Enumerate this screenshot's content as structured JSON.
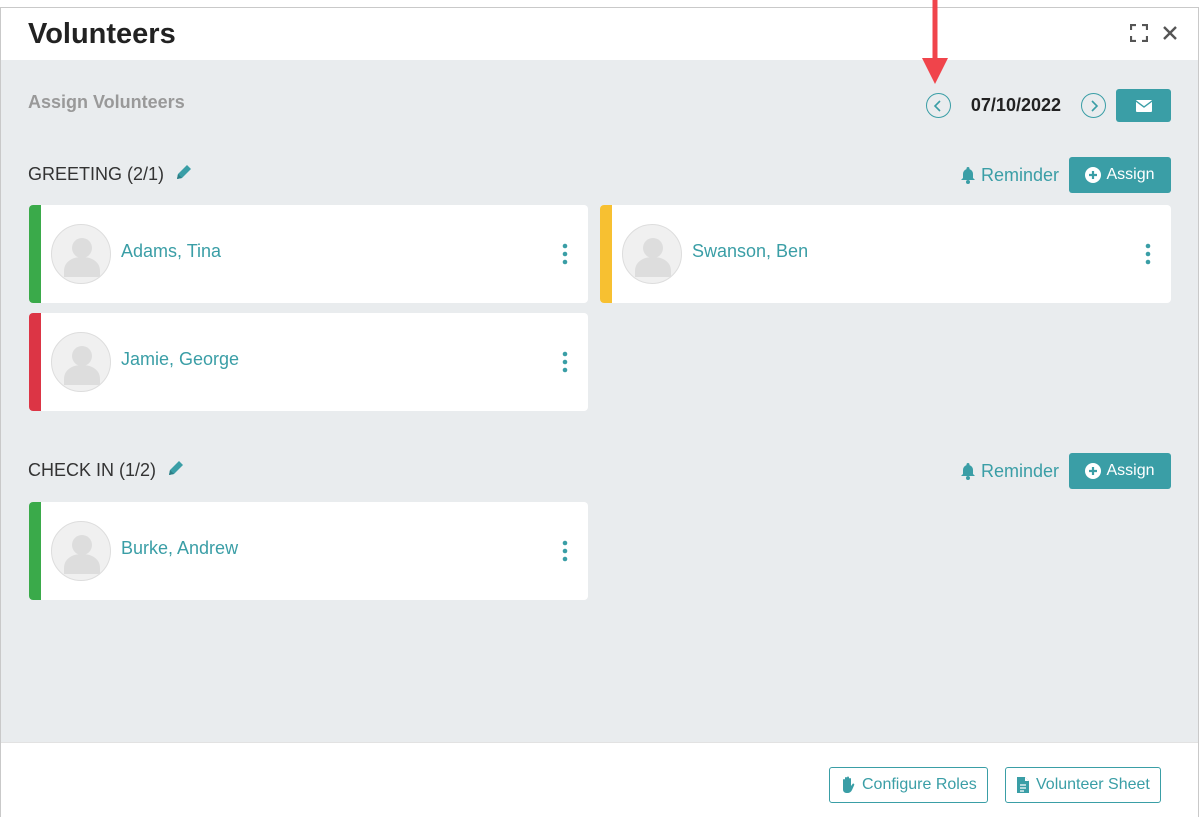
{
  "window": {
    "title": "Volunteers",
    "expand_icon": "expand-icon",
    "close_icon": "close-icon"
  },
  "page": {
    "subtitle": "Assign Volunteers",
    "date": "07/10/2022"
  },
  "sections": [
    {
      "title": "GREETING (2/1)",
      "reminder_label": "Reminder",
      "assign_label": "Assign",
      "volunteers": [
        {
          "name": "Adams, Tina",
          "status_color": "#3aaa4a"
        },
        {
          "name": "Swanson, Ben",
          "status_color": "#f7c031"
        },
        {
          "name": "Jamie, George",
          "status_color": "#dc3545"
        }
      ]
    },
    {
      "title": "CHECK IN (1/2)",
      "reminder_label": "Reminder",
      "assign_label": "Assign",
      "volunteers": [
        {
          "name": "Burke, Andrew",
          "status_color": "#3aaa4a"
        }
      ]
    }
  ],
  "footer": {
    "configure_roles_label": "Configure Roles",
    "volunteer_sheet_label": "Volunteer Sheet"
  },
  "colors": {
    "accent": "#3a9ea6",
    "annotation_arrow": "#f0444b"
  }
}
